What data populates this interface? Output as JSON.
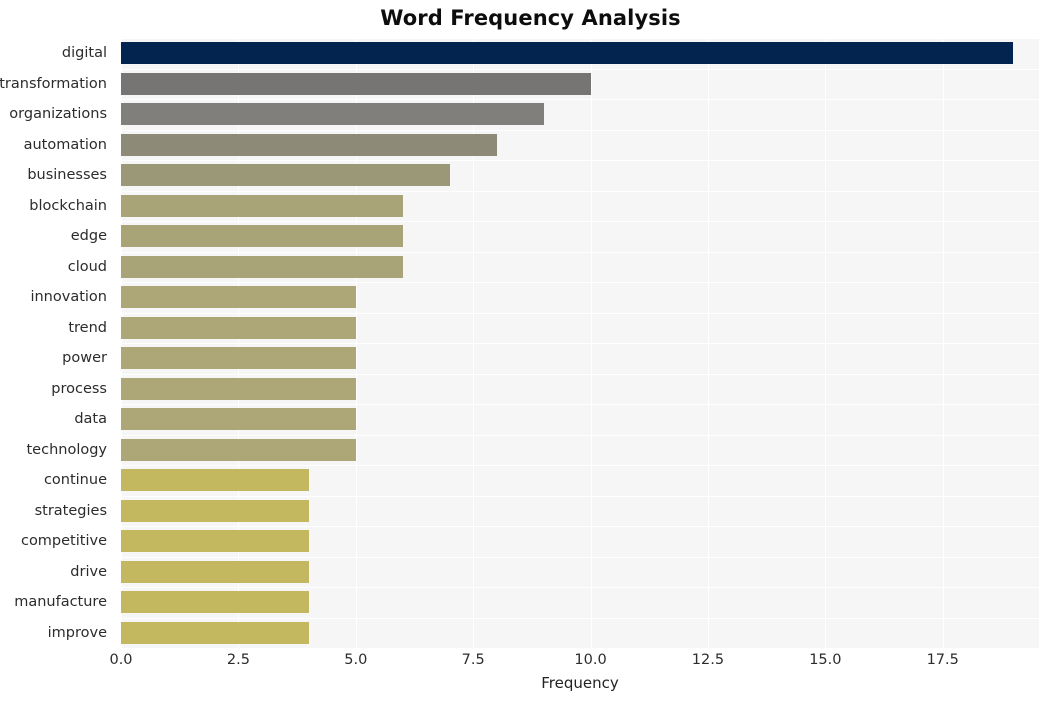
{
  "chart_data": {
    "type": "bar",
    "orientation": "horizontal",
    "title": "Word Frequency Analysis",
    "xlabel": "Frequency",
    "ylabel": "",
    "xlim": [
      0,
      19.55
    ],
    "grid": true,
    "legend": false,
    "xticks": [
      0.0,
      2.5,
      5.0,
      7.5,
      10.0,
      12.5,
      15.0,
      17.5
    ],
    "xtick_labels": [
      "0.0",
      "2.5",
      "5.0",
      "7.5",
      "10.0",
      "12.5",
      "15.0",
      "17.5"
    ],
    "categories": [
      "digital",
      "transformation",
      "organizations",
      "automation",
      "businesses",
      "blockchain",
      "edge",
      "cloud",
      "innovation",
      "trend",
      "power",
      "process",
      "data",
      "technology",
      "continue",
      "strategies",
      "competitive",
      "drive",
      "manufacture",
      "improve"
    ],
    "values": [
      19,
      10,
      9,
      8,
      7,
      6,
      6,
      6,
      5,
      5,
      5,
      5,
      5,
      5,
      4,
      4,
      4,
      4,
      4,
      4
    ],
    "bar_colors": [
      "#042450",
      "#767574",
      "#807f7b",
      "#8d8b78",
      "#9b9878",
      "#a9a477",
      "#a9a477",
      "#a9a477",
      "#ada778",
      "#ada778",
      "#ada778",
      "#ada778",
      "#ada778",
      "#ada778",
      "#c3b75f",
      "#c3b75f",
      "#c3b75f",
      "#c3b75f",
      "#c3b75f",
      "#c3b75f"
    ],
    "colors": {
      "plot_background": "#f6f6f7",
      "figure_background": "#ffffff",
      "grid": "#ffffff",
      "text": "#2c2c2c",
      "title": "#0d0d0d"
    }
  }
}
